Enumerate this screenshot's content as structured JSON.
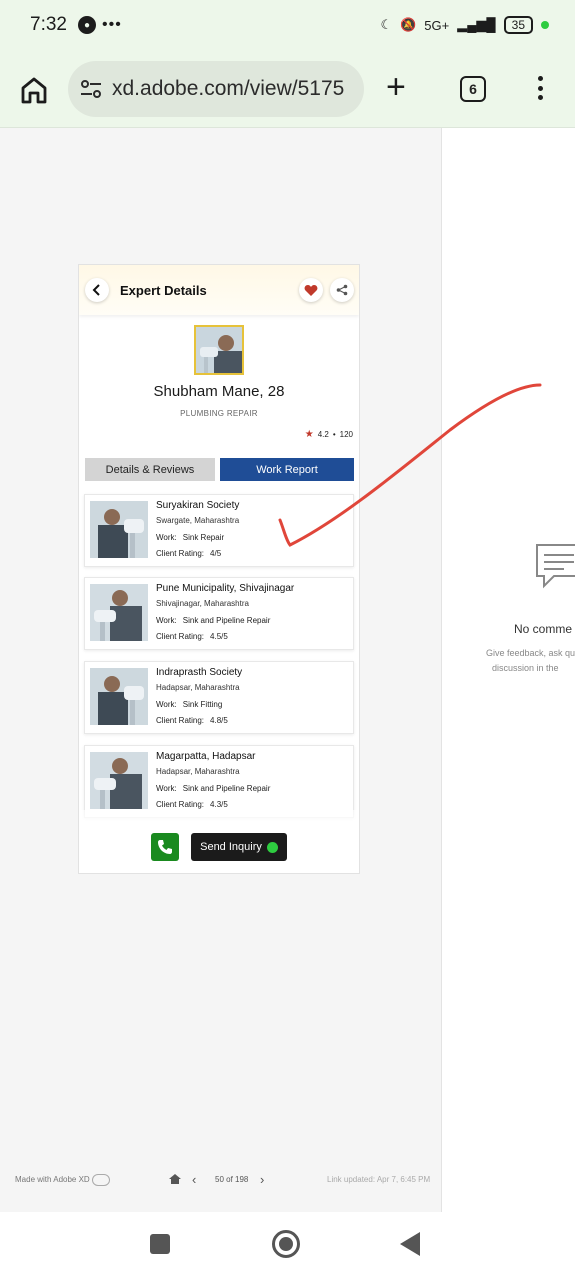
{
  "status_bar": {
    "time": "7:32",
    "network": "5G+",
    "battery": "35"
  },
  "browser": {
    "url": "xd.adobe.com/view/5175",
    "tab_count": "6"
  },
  "expert": {
    "header_title": "Expert Details",
    "name": "Shubham Mane, 28",
    "category": "PLUMBING REPAIR",
    "rating": "4.2",
    "reviews": "120"
  },
  "tabs": {
    "details": "Details & Reviews",
    "work_report": "Work Report"
  },
  "labels": {
    "work": "Work:",
    "client_rating": "Client Rating:"
  },
  "work_items": [
    {
      "title": "Suryakiran Society",
      "location": "Swargate, Maharashtra",
      "work": "Sink Repair",
      "rating": "4/5"
    },
    {
      "title": "Pune Municipality, Shivajinagar",
      "location": "Shivajinagar, Maharashtra",
      "work": "Sink and Pipeline Repair",
      "rating": "4.5/5"
    },
    {
      "title": "Indraprasth Society",
      "location": "Hadapsar, Maharashtra",
      "work": "Sink Fitting",
      "rating": "4.8/5"
    },
    {
      "title": "Magarpatta, Hadapsar",
      "location": "Hadapsar, Maharashtra",
      "work": "Sink and Pipeline Repair",
      "rating": "4.3/5"
    }
  ],
  "actions": {
    "send_inquiry": "Send Inquiry"
  },
  "comments": {
    "empty_title": "No comme",
    "empty_line1": "Give feedback, ask qu",
    "empty_line2": "discussion in the"
  },
  "xd_footer": {
    "made_with": "Made with Adobe XD",
    "page_count": "50 of 198",
    "link_updated": "Link updated: Apr 7, 6:45 PM"
  },
  "colors": {
    "tab_active": "#1f4d96",
    "heart": "#c0392b",
    "call_button": "#1a8a1f",
    "annotation": "#e0463a"
  }
}
